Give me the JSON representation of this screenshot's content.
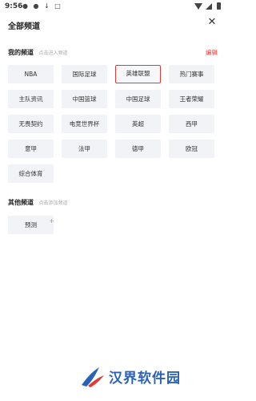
{
  "status_bar": {
    "time": "9:56",
    "left_icons": "● ● ↓ □",
    "right_icons": [
      "wifi-icon",
      "signal-icon",
      "battery-icon"
    ]
  },
  "header": {
    "title": "全部频道",
    "close_icon": "✕"
  },
  "my_channels": {
    "title": "我的频道",
    "hint": "点击进入频道",
    "edit_label": "编辑",
    "selected_index": 2,
    "items": [
      {
        "label": "NBA"
      },
      {
        "label": "国际足球"
      },
      {
        "label": "英雄联盟"
      },
      {
        "label": "热门赛事"
      },
      {
        "label": "主队资讯"
      },
      {
        "label": "中国篮球"
      },
      {
        "label": "中国足球"
      },
      {
        "label": "王者荣耀"
      },
      {
        "label": "无畏契约"
      },
      {
        "label": "电竞世界杯"
      },
      {
        "label": "英超"
      },
      {
        "label": "西甲"
      },
      {
        "label": "意甲"
      },
      {
        "label": "法甲"
      },
      {
        "label": "德甲"
      },
      {
        "label": "欧冠"
      },
      {
        "label": "综合体育"
      }
    ]
  },
  "other_channels": {
    "title": "其他频道",
    "hint": "点击添加频道",
    "items": [
      {
        "label": "预测",
        "badge": "+"
      }
    ]
  },
  "watermark": {
    "text": "汉界软件园",
    "colors": {
      "blue": "#2a62b8",
      "accent": "#e53935"
    }
  }
}
